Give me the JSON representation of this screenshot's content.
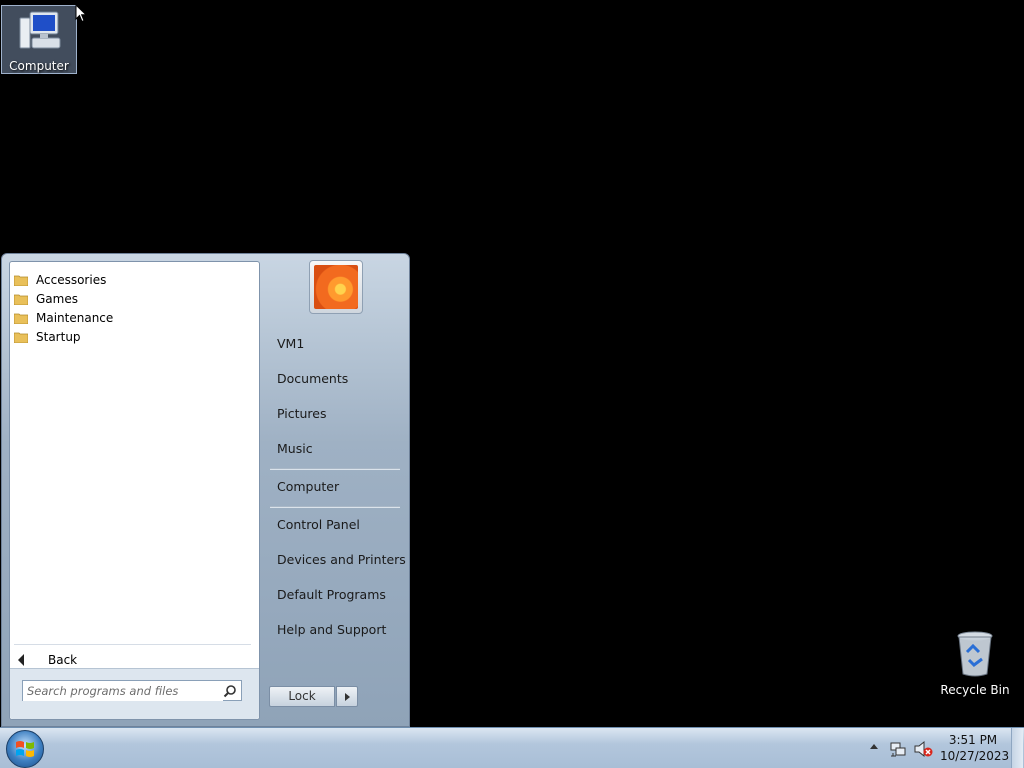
{
  "desktop": {
    "icons": [
      {
        "label": "Computer",
        "icon": "computer-icon"
      },
      {
        "label": "Recycle Bin",
        "icon": "recycle-bin-icon"
      }
    ]
  },
  "start_menu": {
    "programs": [
      {
        "label": "Accessories",
        "icon": "folder-icon"
      },
      {
        "label": "Games",
        "icon": "folder-icon"
      },
      {
        "label": "Maintenance",
        "icon": "folder-icon"
      },
      {
        "label": "Startup",
        "icon": "folder-icon"
      }
    ],
    "back_label": "Back",
    "search_placeholder": "Search programs and files",
    "right_items": [
      {
        "label": "VM1"
      },
      {
        "label": "Documents"
      },
      {
        "label": "Pictures"
      },
      {
        "label": "Music"
      },
      {
        "label": "Computer"
      },
      {
        "label": "Control Panel"
      },
      {
        "label": "Devices and Printers"
      },
      {
        "label": "Default Programs"
      },
      {
        "label": "Help and Support"
      }
    ],
    "lock_label": "Lock"
  },
  "taskbar": {
    "time": "3:51 PM",
    "date": "10/27/2023",
    "tray_icons": [
      "show-hidden-icons-arrow",
      "network-icon",
      "volume-muted-icon"
    ]
  },
  "colors": {
    "desktop_background": "#000000",
    "taskbar": "#b2c6dc",
    "start_menu_right_pane": "#9fb1c4"
  }
}
